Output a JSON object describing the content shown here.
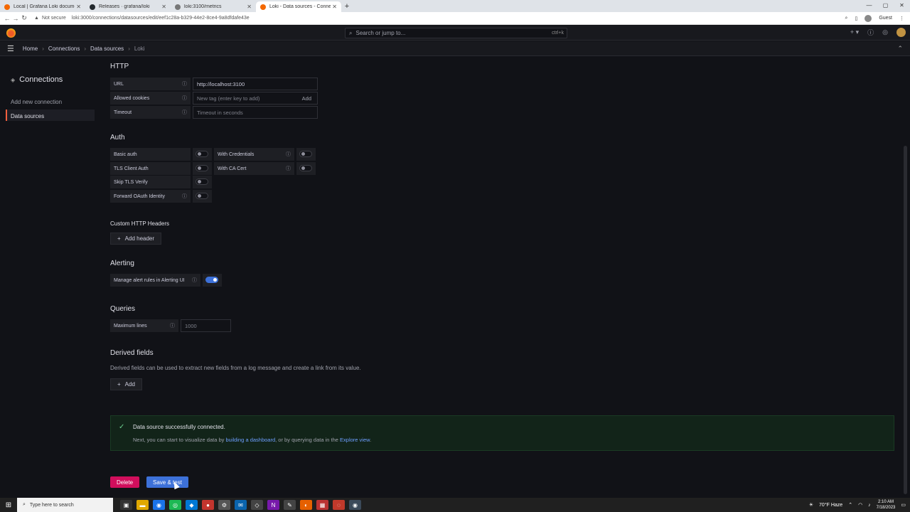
{
  "browser": {
    "tabs": [
      {
        "title": "Local | Grafana Loki documentat...",
        "color": "#f46800"
      },
      {
        "title": "Releases · grafana/loki",
        "color": "#24292e"
      },
      {
        "title": "loki:3100/metrics",
        "color": "#777777"
      },
      {
        "title": "Loki - Data sources - Connection...",
        "color": "#f46800"
      }
    ],
    "not_secure": "Not secure",
    "url": "loki:3000/connections/datasources/edit/eef1c28a-b329-44e2-8ce4-9a8dfdafe43e",
    "guest": "Guest"
  },
  "topnav": {
    "search_placeholder": "Search or jump to...",
    "shortcut": "ctrl+k"
  },
  "breadcrumb": [
    "Home",
    "Connections",
    "Data sources",
    "Loki"
  ],
  "sidebar": {
    "title": "Connections",
    "items": [
      "Add new connection",
      "Data sources"
    ]
  },
  "http": {
    "heading": "HTTP",
    "url_label": "URL",
    "url_value": "http://localhost:3100",
    "cookies_label": "Allowed cookies",
    "cookies_placeholder": "New tag (enter key to add)",
    "cookies_add": "Add",
    "timeout_label": "Timeout",
    "timeout_placeholder": "Timeout in seconds"
  },
  "auth": {
    "heading": "Auth",
    "basic_auth": "Basic auth",
    "with_credentials": "With Credentials",
    "tls_client_auth": "TLS Client Auth",
    "with_ca_cert": "With CA Cert",
    "skip_tls": "Skip TLS Verify",
    "forward_oauth": "Forward OAuth Identity"
  },
  "headers": {
    "heading": "Custom HTTP Headers",
    "add_header": "Add header"
  },
  "alerting": {
    "heading": "Alerting",
    "manage_label": "Manage alert rules in Alerting UI",
    "manage_on": true
  },
  "queries": {
    "heading": "Queries",
    "max_lines_label": "Maximum lines",
    "max_lines_placeholder": "1000"
  },
  "derived": {
    "heading": "Derived fields",
    "description": "Derived fields can be used to extract new fields from a log message and create a link from its value.",
    "add": "Add"
  },
  "alert": {
    "title": "Data source successfully connected.",
    "text_before": "Next, you can start to visualize data by",
    "link1": "building a dashboard",
    "text_mid": ", or by querying data in the",
    "link2": "Explore view",
    "text_after": "."
  },
  "actions": {
    "delete": "Delete",
    "save_test": "Save & test"
  },
  "taskbar": {
    "search": "Type here to search",
    "weather": "70°F Haze",
    "time": "2:10 AM",
    "date": "7/18/2023"
  }
}
